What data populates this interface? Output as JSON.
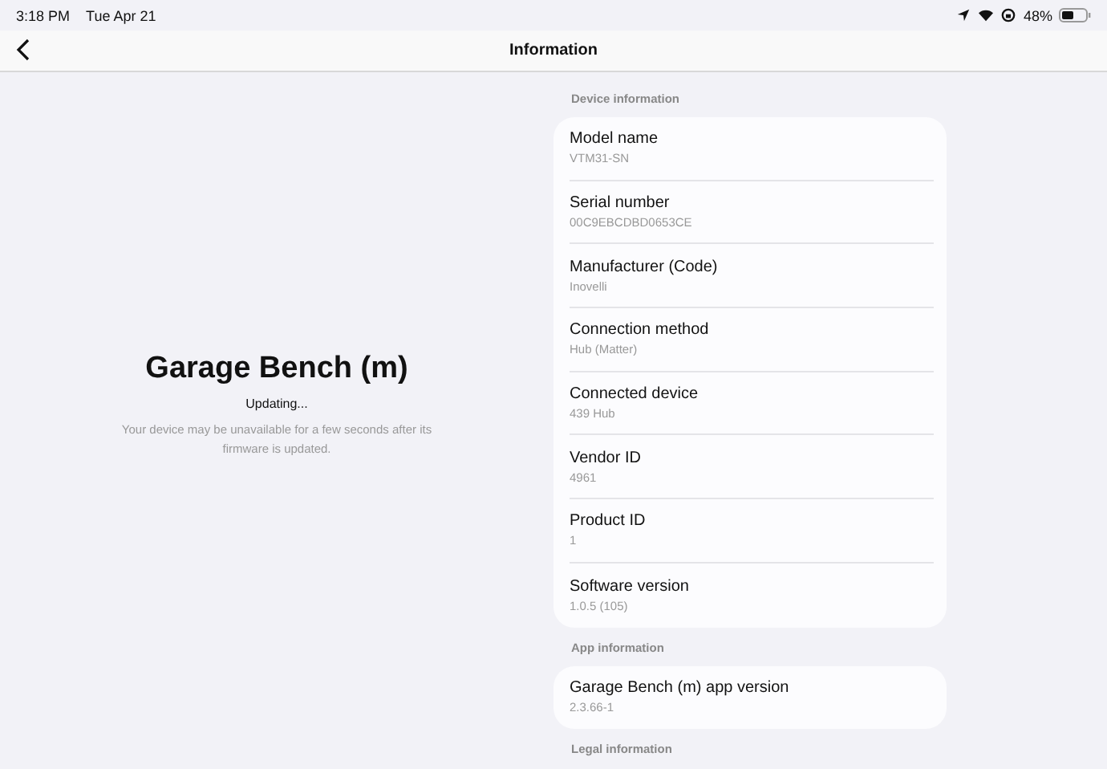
{
  "status_bar": {
    "time": "3:18 PM",
    "date": "Tue Apr 21",
    "battery": "48%"
  },
  "nav": {
    "title": "Information"
  },
  "device": {
    "name": "Garage Bench (m)",
    "status": "Updating...",
    "note": "Your device may be unavailable for a few seconds after its firmware is updated."
  },
  "sections": [
    {
      "header": "Device information",
      "items": [
        {
          "label": "Model name",
          "value": "VTM31-SN"
        },
        {
          "label": "Serial number",
          "value": "00C9EBCDBD0653CE"
        },
        {
          "label": "Manufacturer (Code)",
          "value": "Inovelli"
        },
        {
          "label": "Connection method",
          "value": "Hub (Matter)"
        },
        {
          "label": "Connected device",
          "value": "439 Hub"
        },
        {
          "label": "Vendor ID",
          "value": "4961"
        },
        {
          "label": "Product ID",
          "value": "1"
        },
        {
          "label": "Software version",
          "value": "1.0.5 (105)"
        }
      ]
    },
    {
      "header": "App information",
      "items": [
        {
          "label": "Garage Bench (m) app version",
          "value": "2.3.66-1"
        }
      ]
    },
    {
      "header": "Legal information"
    }
  ]
}
